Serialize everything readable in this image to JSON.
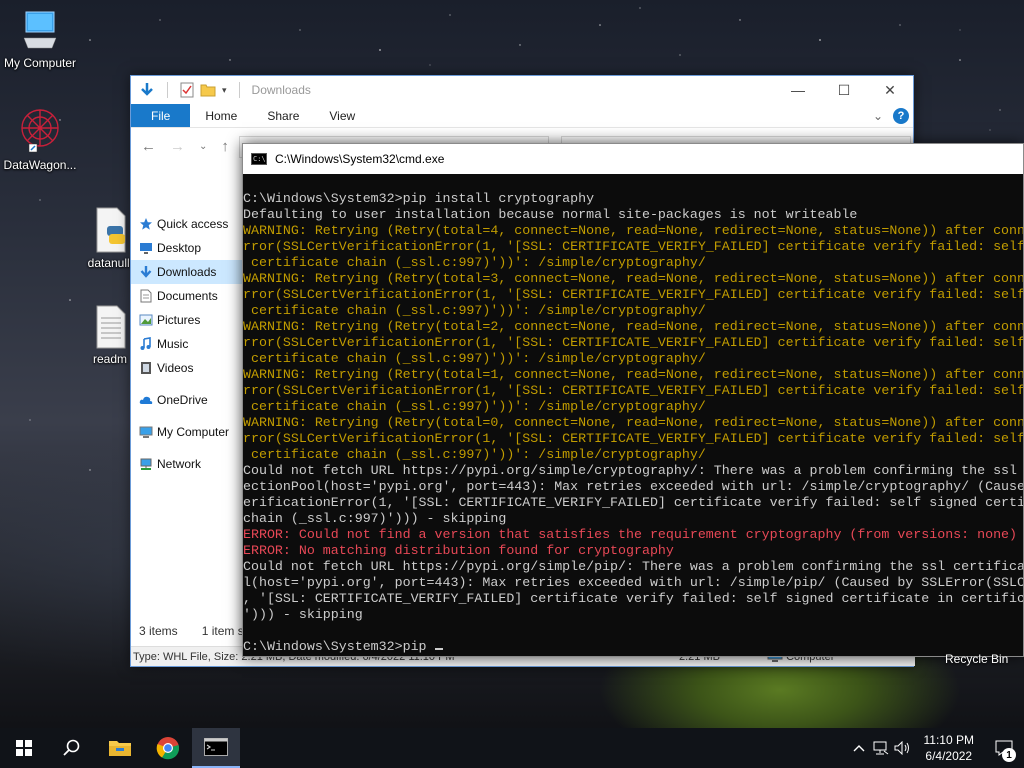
{
  "desktop": {
    "icons": [
      {
        "label": "My Computer"
      },
      {
        "label": "DataWagon..."
      },
      {
        "label": "datanulli"
      },
      {
        "label": "readm"
      }
    ],
    "recycle_bin": "Recycle Bin"
  },
  "explorer": {
    "title": "Downloads",
    "ribbon": {
      "file": "File",
      "home": "Home",
      "share": "Share",
      "view": "View"
    },
    "nav": [
      {
        "label": "Quick access",
        "icon": "star-icon"
      },
      {
        "label": "Desktop",
        "icon": "desktop-icon"
      },
      {
        "label": "Downloads",
        "icon": "download-icon",
        "selected": true
      },
      {
        "label": "Documents",
        "icon": "document-icon"
      },
      {
        "label": "Pictures",
        "icon": "picture-icon"
      },
      {
        "label": "Music",
        "icon": "music-icon"
      },
      {
        "label": "Videos",
        "icon": "video-icon"
      },
      {
        "label": "OneDrive",
        "icon": "cloud-icon"
      },
      {
        "label": "My Computer",
        "icon": "computer-icon"
      },
      {
        "label": "Network",
        "icon": "network-icon"
      }
    ],
    "status": {
      "items": "3 items",
      "selected": "1 item s"
    },
    "bottom": {
      "details": "Type: WHL File, Size: 2.21 MB, Date modified: 6/4/2022 11:10 PM",
      "size": "2.21 MB",
      "location": "Computer"
    }
  },
  "cmd": {
    "title": "C:\\Windows\\System32\\cmd.exe",
    "lines": [
      {
        "t": "C:\\Windows\\System32>pip install cryptography",
        "c": "w"
      },
      {
        "t": "Defaulting to user installation because normal site-packages is not writeable",
        "c": "w"
      },
      {
        "t": "WARNING: Retrying (Retry(total=4, connect=None, read=None, redirect=None, status=None)) after conn",
        "c": "y"
      },
      {
        "t": "rror(SSLCertVerificationError(1, '[SSL: CERTIFICATE_VERIFY_FAILED] certificate verify failed: self",
        "c": "y"
      },
      {
        "t": " certificate chain (_ssl.c:997)'))': /simple/cryptography/",
        "c": "y"
      },
      {
        "t": "WARNING: Retrying (Retry(total=3, connect=None, read=None, redirect=None, status=None)) after conn",
        "c": "y"
      },
      {
        "t": "rror(SSLCertVerificationError(1, '[SSL: CERTIFICATE_VERIFY_FAILED] certificate verify failed: self",
        "c": "y"
      },
      {
        "t": " certificate chain (_ssl.c:997)'))': /simple/cryptography/",
        "c": "y"
      },
      {
        "t": "WARNING: Retrying (Retry(total=2, connect=None, read=None, redirect=None, status=None)) after conn",
        "c": "y"
      },
      {
        "t": "rror(SSLCertVerificationError(1, '[SSL: CERTIFICATE_VERIFY_FAILED] certificate verify failed: self",
        "c": "y"
      },
      {
        "t": " certificate chain (_ssl.c:997)'))': /simple/cryptography/",
        "c": "y"
      },
      {
        "t": "WARNING: Retrying (Retry(total=1, connect=None, read=None, redirect=None, status=None)) after conn",
        "c": "y"
      },
      {
        "t": "rror(SSLCertVerificationError(1, '[SSL: CERTIFICATE_VERIFY_FAILED] certificate verify failed: self",
        "c": "y"
      },
      {
        "t": " certificate chain (_ssl.c:997)'))': /simple/cryptography/",
        "c": "y"
      },
      {
        "t": "WARNING: Retrying (Retry(total=0, connect=None, read=None, redirect=None, status=None)) after conn",
        "c": "y"
      },
      {
        "t": "rror(SSLCertVerificationError(1, '[SSL: CERTIFICATE_VERIFY_FAILED] certificate verify failed: self",
        "c": "y"
      },
      {
        "t": " certificate chain (_ssl.c:997)'))': /simple/cryptography/",
        "c": "y"
      },
      {
        "t": "Could not fetch URL https://pypi.org/simple/cryptography/: There was a problem confirming the ssl",
        "c": "w"
      },
      {
        "t": "ectionPool(host='pypi.org', port=443): Max retries exceeded with url: /simple/cryptography/ (Cause",
        "c": "w"
      },
      {
        "t": "erificationError(1, '[SSL: CERTIFICATE_VERIFY_FAILED] certificate verify failed: self signed certi",
        "c": "w"
      },
      {
        "t": "chain (_ssl.c:997)'))) - skipping",
        "c": "w"
      },
      {
        "t": "ERROR: Could not find a version that satisfies the requirement cryptography (from versions: none)",
        "c": "r"
      },
      {
        "t": "ERROR: No matching distribution found for cryptography",
        "c": "r"
      },
      {
        "t": "Could not fetch URL https://pypi.org/simple/pip/: There was a problem confirming the ssl certifica",
        "c": "w"
      },
      {
        "t": "l(host='pypi.org', port=443): Max retries exceeded with url: /simple/pip/ (Caused by SSLError(SSLC",
        "c": "w"
      },
      {
        "t": ", '[SSL: CERTIFICATE_VERIFY_FAILED] certificate verify failed: self signed certificate in certific",
        "c": "w"
      },
      {
        "t": "'))) - skipping",
        "c": "w"
      },
      {
        "t": "",
        "c": "w"
      },
      {
        "t": "C:\\Windows\\System32>pip ",
        "c": "w"
      }
    ]
  },
  "taskbar": {
    "time": "11:10 PM",
    "date": "6/4/2022",
    "notifications": "1"
  },
  "colors": {
    "cmd_white": "#cccccc",
    "cmd_yellow": "#c19c00",
    "cmd_red": "#e74856",
    "accent": "#1979ca"
  }
}
